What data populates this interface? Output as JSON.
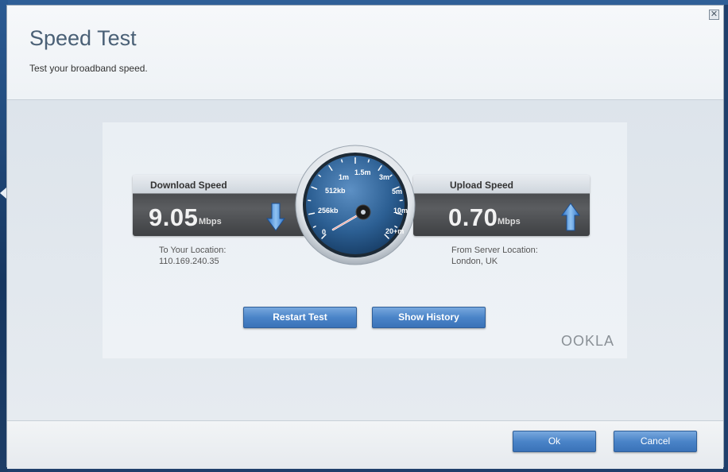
{
  "dialog": {
    "title": "Speed Test",
    "subtitle": "Test your broadband speed.",
    "close_icon": "close-icon"
  },
  "download": {
    "label": "Download Speed",
    "value": "9.05",
    "unit": "Mbps",
    "location_label": "To Your Location:",
    "location_value": "110.169.240.35",
    "icon": "arrow-down-icon"
  },
  "upload": {
    "label": "Upload Speed",
    "value": "0.70",
    "unit": "Mbps",
    "location_label": "From Server Location:",
    "location_value": "London, UK",
    "icon": "arrow-up-icon"
  },
  "gauge": {
    "ticks": [
      "0",
      "256kb",
      "512kb",
      "1m",
      "1.5m",
      "3m",
      "5m",
      "10m",
      "20+m"
    ],
    "needle_icon": "gauge-needle"
  },
  "buttons": {
    "restart": "Restart Test",
    "history": "Show History",
    "ok": "Ok",
    "cancel": "Cancel"
  },
  "brand": "OOKLA",
  "colors": {
    "accent": "#4a84c8",
    "gauge_face": "#2c5f93",
    "needle": "#ffffff"
  }
}
